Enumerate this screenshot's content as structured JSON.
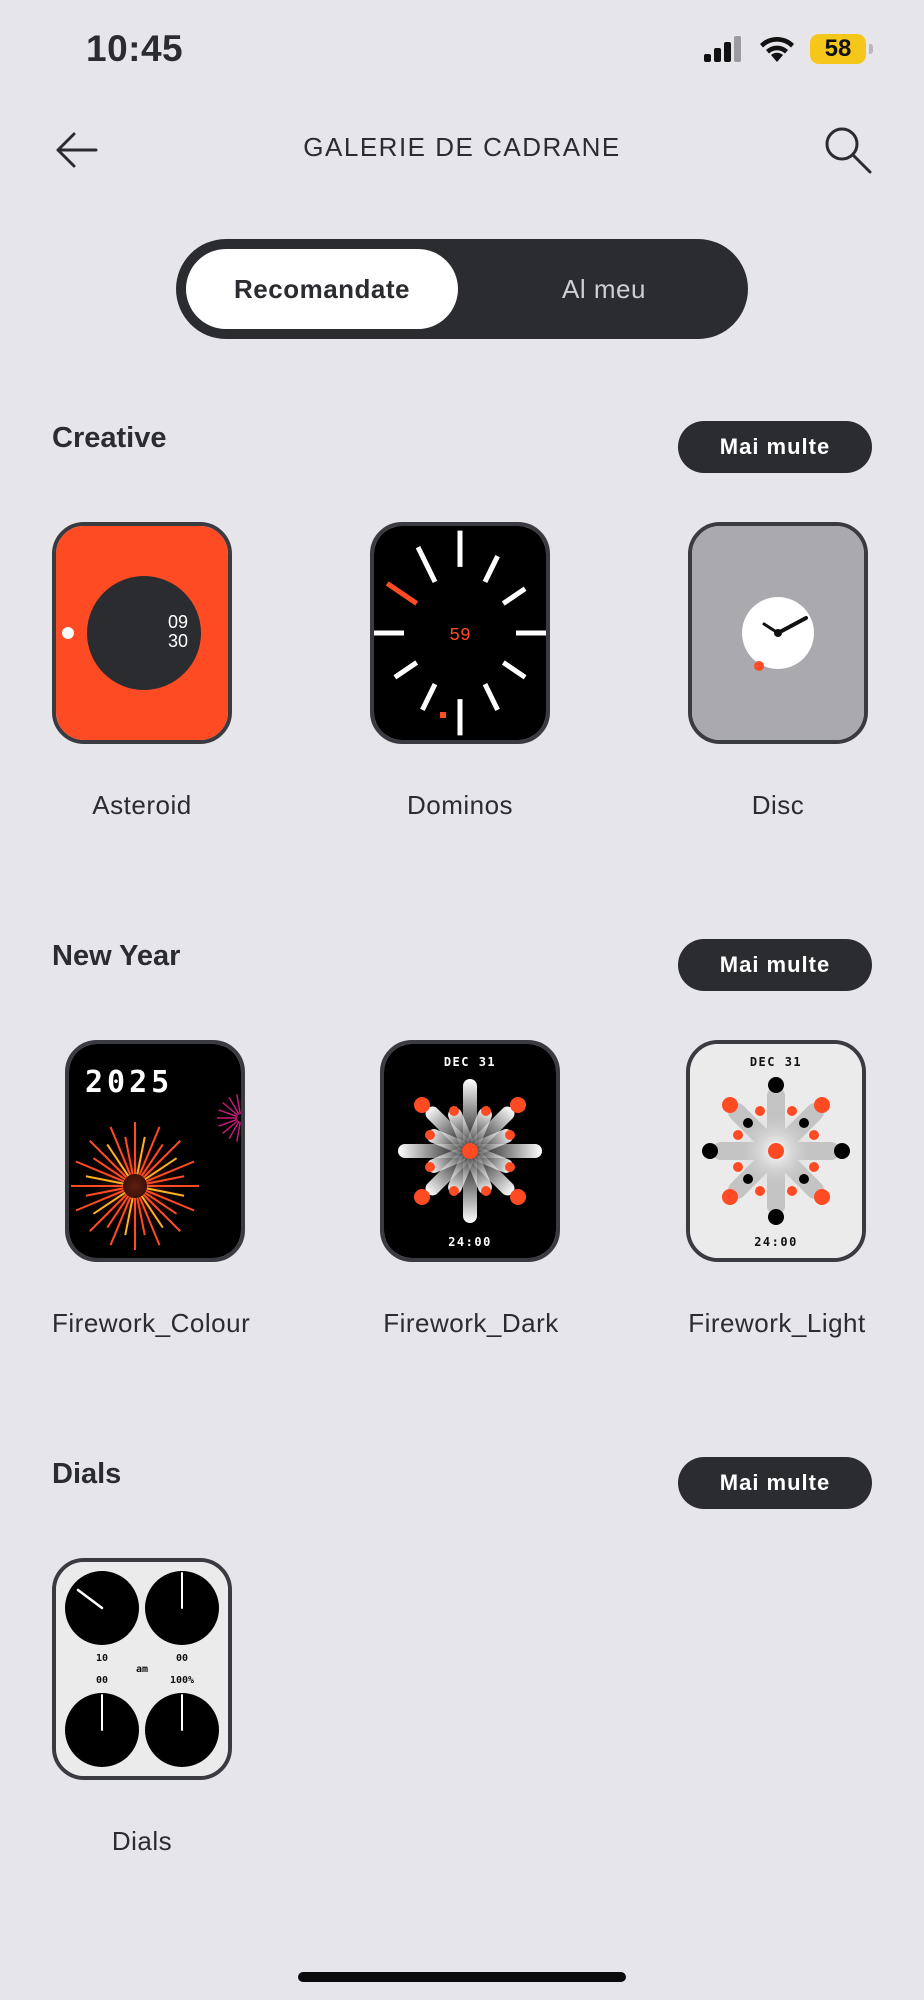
{
  "status": {
    "time": "10:45",
    "battery": "58"
  },
  "header": {
    "title": "GALERIE DE CADRANE"
  },
  "tabs": {
    "active": "Recomandate",
    "inactive": "Al meu"
  },
  "sections": [
    {
      "title": "Creative",
      "more": "Mai multe",
      "faces": [
        {
          "label": "Asteroid",
          "hour": "09",
          "minute": "30"
        },
        {
          "label": "Dominos",
          "seconds": "59"
        },
        {
          "label": "Disc"
        }
      ]
    },
    {
      "title": "New Year",
      "more": "Mai multe",
      "faces": [
        {
          "label": "Firework_Colour",
          "year": "2025"
        },
        {
          "label": "Firework_Dark",
          "date": "DEC 31",
          "time": "24:00"
        },
        {
          "label": "Firework_Light",
          "date": "DEC 31",
          "time": "24:00"
        }
      ]
    },
    {
      "title": "Dials",
      "more": "Mai multe",
      "faces": [
        {
          "label": "Dials",
          "hour": "10",
          "minute": "00",
          "minute2": "00",
          "battery": "100%",
          "ampm": "am"
        }
      ]
    }
  ],
  "colors": {
    "accent": "#ff4b23",
    "dark": "#2b2c30",
    "background": "#e6e5ea"
  }
}
